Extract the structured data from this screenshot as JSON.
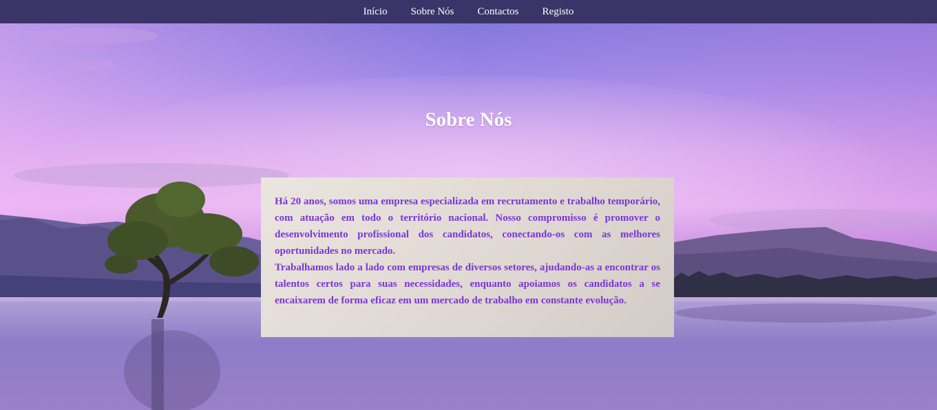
{
  "nav": {
    "items": [
      "Início",
      "Sobre Nós",
      "Contactos",
      "Registo"
    ]
  },
  "page": {
    "title": "Sobre Nós"
  },
  "about": {
    "paragraph_1": "Há 20 anos, somos uma empresa especializada em recrutamento e trabalho temporário, com atuação em todo o território nacional. Nosso compromisso é promover o desenvolvimento profissional dos candidatos, conectando-os com as melhores oportunidades no mercado.",
    "paragraph_2": "Trabalhamos lado a lado com empresas de diversos setores, ajudando-as a encontrar os talentos certos para suas necessidades, enquanto apoiamos os candidatos a se encaixarem de forma eficaz em um mercado de trabalho em constante evolução."
  },
  "colors": {
    "nav_bg": "#3a3468",
    "text_accent": "#7b35d6",
    "card_bg": "#e6e0da"
  }
}
